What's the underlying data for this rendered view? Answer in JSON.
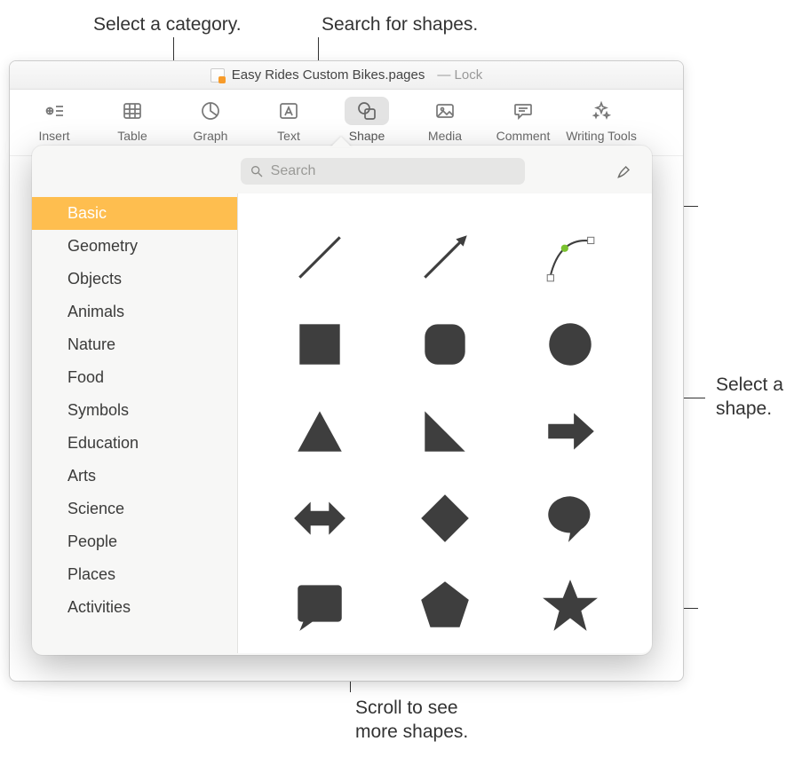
{
  "annotations": {
    "category": "Select a category.",
    "search": "Search for shapes.",
    "select_shape_l1": "Select a",
    "select_shape_l2": "shape.",
    "scroll_l1": "Scroll to see",
    "scroll_l2": "more shapes."
  },
  "titlebar": {
    "doc_name": "Easy Rides Custom Bikes.pages",
    "lock_label": "— Lock"
  },
  "toolbar": {
    "items": [
      {
        "label": "Insert",
        "icon": "insert"
      },
      {
        "label": "Table",
        "icon": "table"
      },
      {
        "label": "Graph",
        "icon": "graph"
      },
      {
        "label": "Text",
        "icon": "text"
      },
      {
        "label": "Shape",
        "icon": "shape",
        "active": true
      },
      {
        "label": "Media",
        "icon": "media"
      },
      {
        "label": "Comment",
        "icon": "comment"
      },
      {
        "label": "Writing Tools",
        "icon": "writing"
      }
    ]
  },
  "search": {
    "placeholder": "Search"
  },
  "categories": [
    {
      "label": "Basic",
      "selected": true
    },
    {
      "label": "Geometry"
    },
    {
      "label": "Objects"
    },
    {
      "label": "Animals"
    },
    {
      "label": "Nature"
    },
    {
      "label": "Food"
    },
    {
      "label": "Symbols"
    },
    {
      "label": "Education"
    },
    {
      "label": "Arts"
    },
    {
      "label": "Science"
    },
    {
      "label": "People"
    },
    {
      "label": "Places"
    },
    {
      "label": "Activities"
    }
  ],
  "shapes": [
    {
      "name": "line"
    },
    {
      "name": "arrow-line"
    },
    {
      "name": "curve"
    },
    {
      "name": "square"
    },
    {
      "name": "rounded-square"
    },
    {
      "name": "circle"
    },
    {
      "name": "triangle"
    },
    {
      "name": "right-triangle"
    },
    {
      "name": "right-arrow"
    },
    {
      "name": "double-arrow"
    },
    {
      "name": "diamond"
    },
    {
      "name": "speech-bubble"
    },
    {
      "name": "callout-square"
    },
    {
      "name": "pentagon"
    },
    {
      "name": "star"
    }
  ]
}
